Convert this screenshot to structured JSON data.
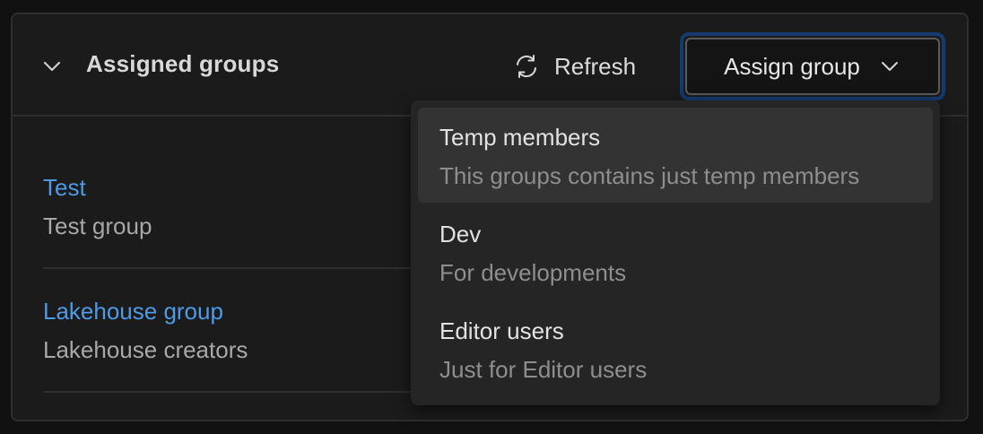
{
  "section": {
    "title": "Assigned groups",
    "refresh_label": "Refresh",
    "assign_label": "Assign group"
  },
  "groups": [
    {
      "name": "Test",
      "description": "Test group"
    },
    {
      "name": "Lakehouse group",
      "description": "Lakehouse creators"
    }
  ],
  "dropdown": {
    "options": [
      {
        "title": "Temp members",
        "description": "This groups contains just temp members",
        "hovered": true
      },
      {
        "title": "Dev",
        "description": "For developments",
        "hovered": false
      },
      {
        "title": "Editor users",
        "description": "Just for Editor users",
        "hovered": false
      }
    ]
  },
  "colors": {
    "link": "#4f9ae6",
    "focus_ring": "#143a6e",
    "background": "#1b1b1b"
  },
  "icons": [
    "chevron-down-icon",
    "refresh-icon",
    "chevron-down-icon"
  ]
}
